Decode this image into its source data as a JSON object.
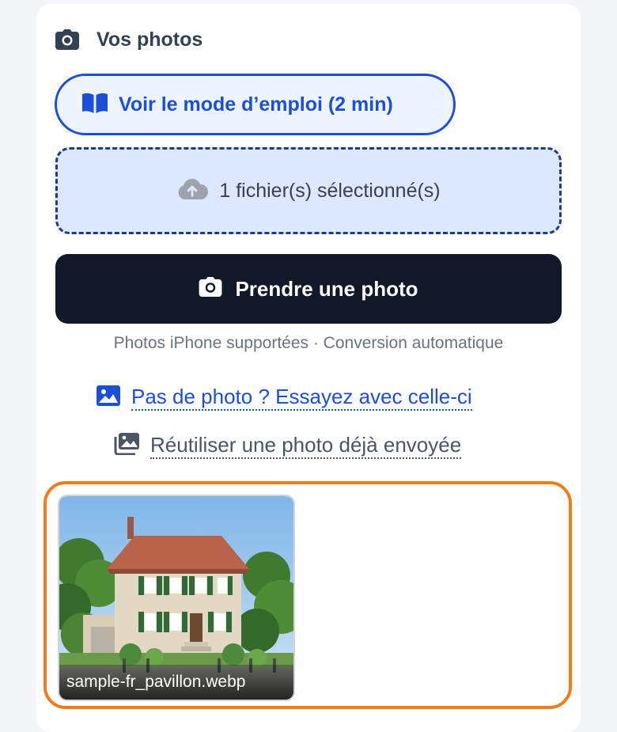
{
  "header": {
    "title": "Vos photos",
    "icon": "camera-icon"
  },
  "guide_button": {
    "label": "Voir le mode d’emploi (2 min)",
    "icon": "book-open-icon"
  },
  "dropzone": {
    "label": "1 fichier(s) sélectionné(s)",
    "icon": "cloud-upload-icon"
  },
  "take_photo_button": {
    "label": "Prendre une photo",
    "icon": "camera-icon"
  },
  "hint": "Photos iPhone supportées · Conversion automatique",
  "sample_link": {
    "label": "Pas de photo ? Essayez avec celle-ci",
    "icon": "image-icon"
  },
  "reuse_link": {
    "label": "Réutiliser une photo déjà envoyée",
    "icon": "images-stack-icon"
  },
  "preview": {
    "files": [
      {
        "name": "sample-fr_pavillon.webp"
      }
    ]
  },
  "colors": {
    "accent": "#1d4ed8",
    "dark_button": "#111827",
    "highlight": "#f07c1a",
    "dropzone_bg": "#dbe8fd"
  }
}
